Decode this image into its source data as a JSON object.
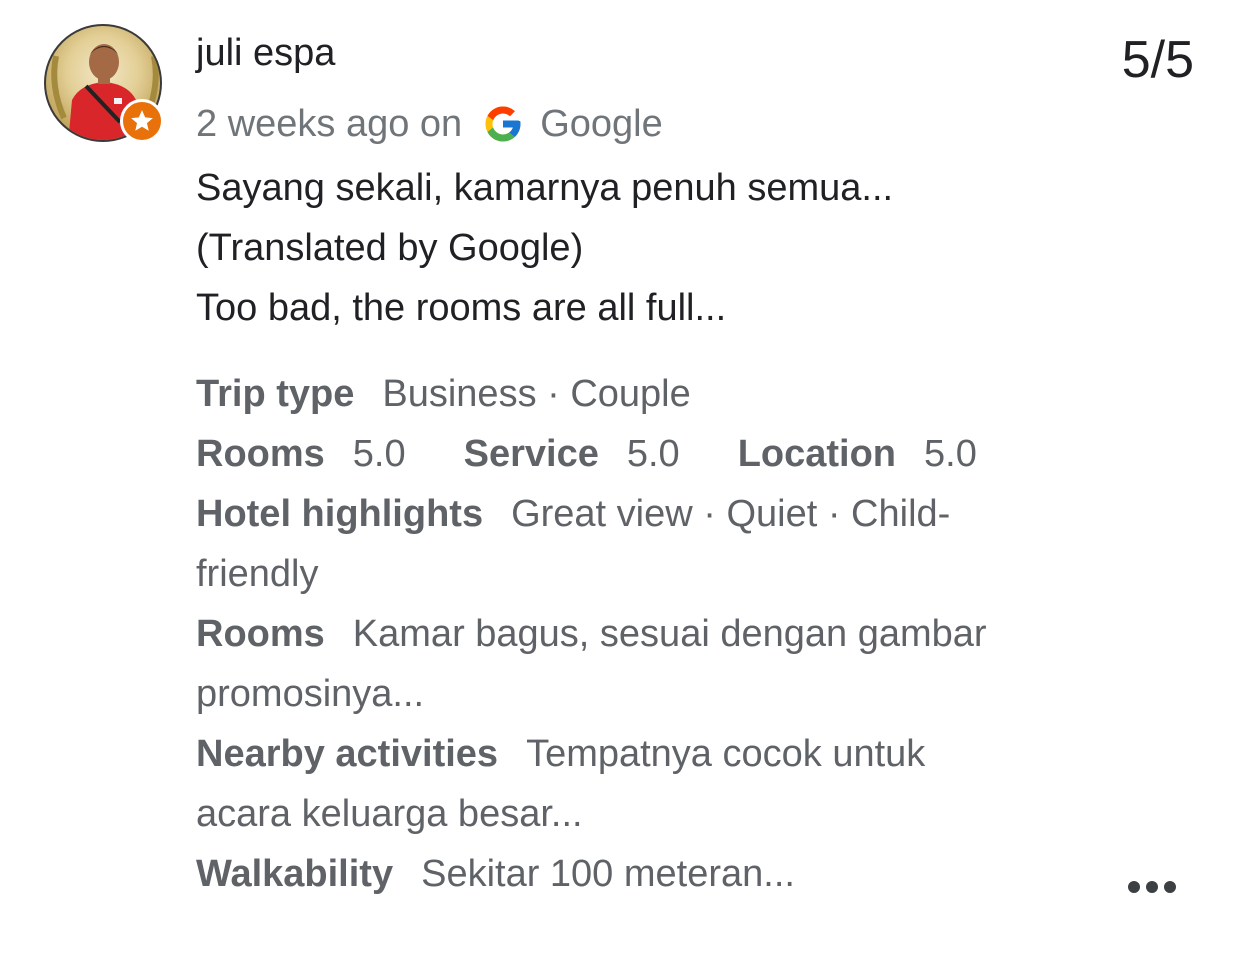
{
  "review": {
    "reviewer_name": "juli espa",
    "counter": "5/5",
    "time_ago": "2 weeks ago on",
    "source": "Google",
    "text_lines": [
      "Sayang sekali, kamarnya penuh semua...",
      "(Translated by Google)",
      "Too bad, the rooms are all full..."
    ]
  },
  "details": {
    "trip_type_label": "Trip type",
    "trip_type_value": "Business · Couple",
    "ratings": [
      {
        "label": "Rooms",
        "value": "5.0"
      },
      {
        "label": "Service",
        "value": "5.0"
      },
      {
        "label": "Location",
        "value": "5.0"
      }
    ],
    "highlights_label": "Hotel highlights",
    "highlights_value_line1": "Great view · Quiet · Child-",
    "highlights_value_line2": "friendly",
    "rooms_label": "Rooms",
    "rooms_value_line1": "Kamar bagus, sesuai dengan gambar",
    "rooms_value_line2": "promosinya...",
    "nearby_label": "Nearby activities",
    "nearby_value_line1": "Tempatnya cocok untuk",
    "nearby_value_line2": "acara keluarga besar...",
    "walkability_label": "Walkability",
    "walkability_value": "Sekitar 100 meteran..."
  },
  "icons": {
    "avatar": "reviewer-avatar-photo",
    "badge": "local-guide-star-icon",
    "source_logo": "google-g-icon",
    "menu": "more-options-icon"
  },
  "colors": {
    "badge": "#e8710a",
    "text_primary": "#202124",
    "text_secondary": "#5f6368",
    "meta": "#70757a"
  }
}
